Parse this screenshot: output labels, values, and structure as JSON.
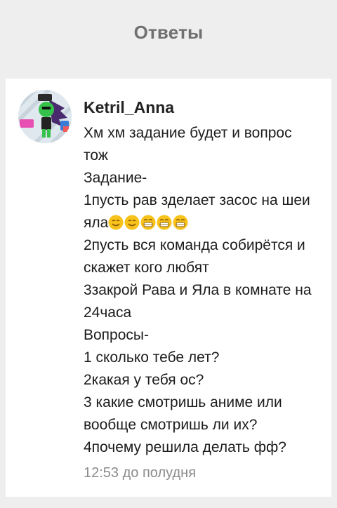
{
  "header": {
    "title": "Ответы"
  },
  "comment": {
    "username": "Ketril_Anna",
    "lines": [
      "Хм хм задание будет и вопрос",
      "тож",
      "Задание-",
      "1пусть рав зделает засос на шеи",
      "яла",
      "2пусть вся команда собирётся и",
      "скажет кого любят",
      "3закрой Рава и Яла в комнате на",
      "24часа",
      "Вопросы-",
      "1 сколько тебе лет?",
      "2какая у тебя ос?",
      "3 какие смотришь аниме или",
      "вообще смотришь ли их?",
      "4почему решила делать фф?"
    ],
    "emojis": [
      "smiling-face-icon",
      "smiling-face-icon",
      "grinning-face-icon",
      "grinning-face-icon",
      "grinning-face-icon"
    ],
    "timestamp": "12:53 до полудня"
  },
  "colors": {
    "background": "#eeeeee",
    "card": "#ffffff",
    "title": "#707070",
    "username": "#222222",
    "text": "#1c1c1c",
    "timestamp": "#8b8b8b",
    "emoji": "#f7c21c"
  }
}
